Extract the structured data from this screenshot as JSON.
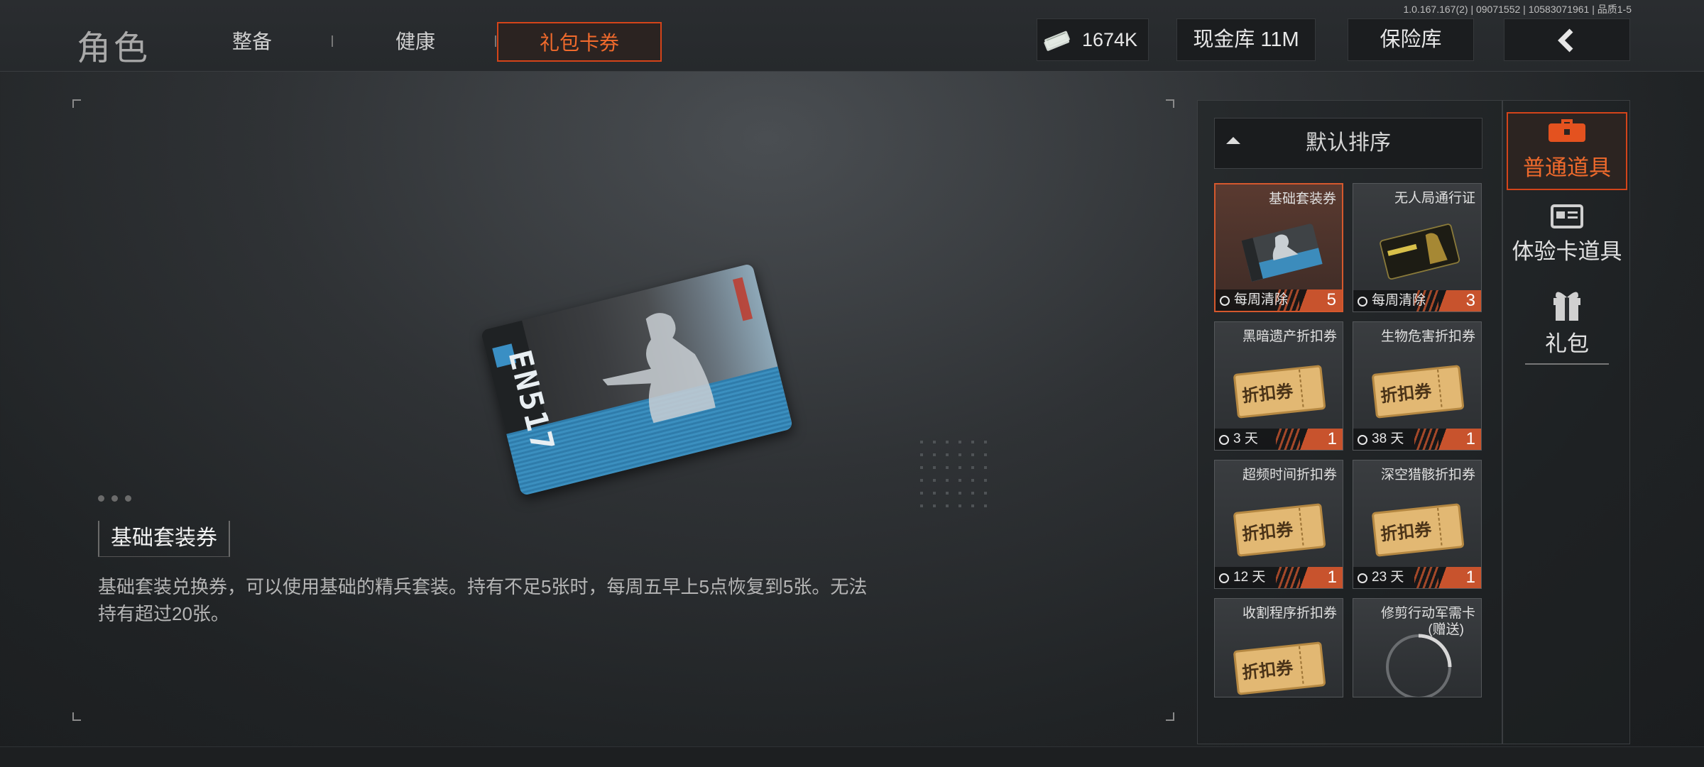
{
  "build_info": "1.0.167.167(2) | 09071552 | 10583071961 | 品质1-5",
  "header": {
    "title": "角色",
    "tabs": [
      {
        "label": "整备"
      },
      {
        "label": "健康"
      },
      {
        "label": "礼包卡券",
        "active": true
      }
    ],
    "currency": "1674K",
    "cash_vault": "现金库 11M",
    "insurance_vault": "保险库",
    "back_icon": "chevron-left-icon"
  },
  "item_detail": {
    "name": "基础套装券",
    "description": "基础套装兑换券，可以使用基础的精兵套装。持有不足5张时，每周五早上5点恢复到5张。无法持有超过20张。",
    "card_text": "EN517"
  },
  "inventory": {
    "sort_label": "默认排序",
    "items": [
      {
        "name": "基础套装券",
        "time": "每周清除",
        "count": "5",
        "icon": "kit-card-icon",
        "selected": true
      },
      {
        "name": "无人局通行证",
        "time": "每周清除",
        "count": "3",
        "icon": "pass-card-icon"
      },
      {
        "name": "黑暗遗产折扣券",
        "time": "3 天",
        "count": "1",
        "icon": "discount-ticket-icon"
      },
      {
        "name": "生物危害折扣券",
        "time": "38 天",
        "count": "1",
        "icon": "discount-ticket-icon"
      },
      {
        "name": "超频时间折扣券",
        "time": "12 天",
        "count": "1",
        "icon": "discount-ticket-icon"
      },
      {
        "name": "深空猎骸折扣券",
        "time": "23 天",
        "count": "1",
        "icon": "discount-ticket-icon"
      },
      {
        "name": "收割程序折扣券",
        "icon": "discount-ticket-icon"
      },
      {
        "name": "修剪行动军需卡",
        "subtitle": "(赠送)",
        "icon": "loading-ring-icon"
      }
    ],
    "ticket_text": "折扣券"
  },
  "categories": [
    {
      "label": "普通道具",
      "icon": "chest-icon",
      "active": true
    },
    {
      "label": "体验卡道具",
      "icon": "id-card-icon"
    },
    {
      "label": "礼包",
      "icon": "gift-icon"
    }
  ],
  "colors": {
    "accent": "#d4441a",
    "accent_text": "#f06a2c"
  }
}
